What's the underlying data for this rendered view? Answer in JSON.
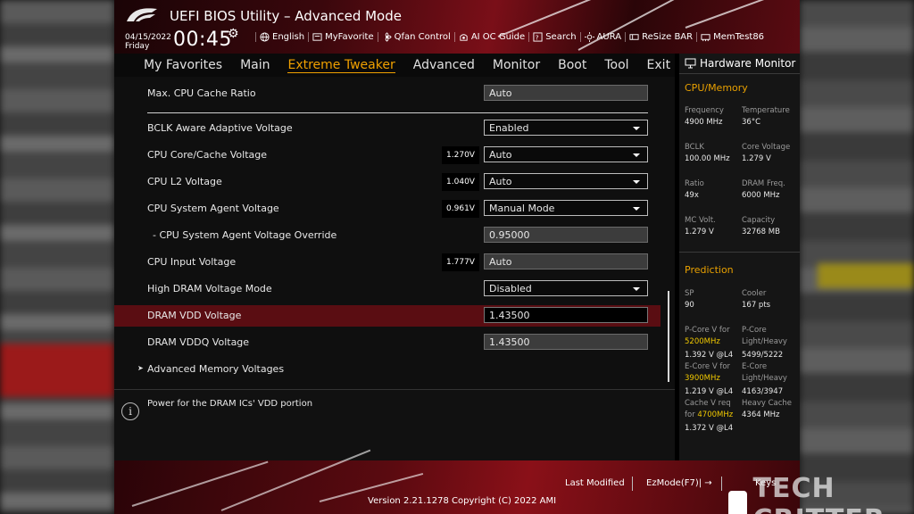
{
  "header": {
    "title": "UEFI BIOS Utility – Advanced Mode",
    "date": "04/15/2022",
    "day": "Friday",
    "time": "00:45",
    "tools": [
      {
        "icon": "globe-icon",
        "label": "English"
      },
      {
        "icon": "myfavorite-icon",
        "label": "MyFavorite"
      },
      {
        "icon": "fan-icon",
        "label": "Qfan Control"
      },
      {
        "icon": "ai-oc-icon",
        "label": "AI OC Guide"
      },
      {
        "icon": "search-icon",
        "label": "Search"
      },
      {
        "icon": "aura-icon",
        "label": "AURA"
      },
      {
        "icon": "resize-bar-icon",
        "label": "ReSize BAR"
      },
      {
        "icon": "memtest-icon",
        "label": "MemTest86"
      }
    ]
  },
  "nav": {
    "items": [
      "My Favorites",
      "Main",
      "Extreme Tweaker",
      "Advanced",
      "Monitor",
      "Boot",
      "Tool",
      "Exit"
    ],
    "active": "Extreme Tweaker"
  },
  "settings": {
    "max_cpu_cache_ratio": {
      "label": "Max. CPU Cache Ratio",
      "value": "Auto"
    },
    "bclk_aware": {
      "label": "BCLK Aware Adaptive Voltage",
      "value": "Enabled"
    },
    "cpu_core_cache": {
      "label": "CPU Core/Cache Voltage",
      "current": "1.270V",
      "value": "Auto"
    },
    "cpu_l2": {
      "label": "CPU L2 Voltage",
      "current": "1.040V",
      "value": "Auto"
    },
    "cpu_sa": {
      "label": "CPU System Agent Voltage",
      "current": "0.961V",
      "value": "Manual Mode"
    },
    "cpu_sa_override": {
      "label": "- CPU System Agent Voltage Override",
      "value": "0.95000"
    },
    "cpu_input": {
      "label": "CPU Input Voltage",
      "current": "1.777V",
      "value": "Auto"
    },
    "high_dram": {
      "label": "High DRAM Voltage Mode",
      "value": "Disabled"
    },
    "dram_vdd": {
      "label": "DRAM VDD Voltage",
      "value": "1.43500"
    },
    "dram_vddq": {
      "label": "DRAM VDDQ Voltage",
      "value": "1.43500"
    },
    "adv_mem": {
      "label": "Advanced Memory Voltages"
    }
  },
  "help": {
    "text": "Power for the DRAM ICs' VDD portion"
  },
  "hw_monitor": {
    "title": "Hardware Monitor",
    "cpu_memory_heading": "CPU/Memory",
    "frequency_label": "Frequency",
    "frequency": "4900 MHz",
    "temperature_label": "Temperature",
    "temperature": "36°C",
    "bclk_label": "BCLK",
    "bclk": "100.00 MHz",
    "core_voltage_label": "Core Voltage",
    "core_voltage": "1.279 V",
    "ratio_label": "Ratio",
    "ratio": "49x",
    "dram_freq_label": "DRAM Freq.",
    "dram_freq": "6000 MHz",
    "mc_volt_label": "MC Volt.",
    "mc_volt": "1.279 V",
    "capacity_label": "Capacity",
    "capacity": "32768 MB",
    "prediction_heading": "Prediction",
    "sp_label": "SP",
    "sp": "90",
    "cooler_label": "Cooler",
    "cooler": "167 pts",
    "pcore_v_for": "P-Core V for",
    "pcore_freq": "5200MHz",
    "pcore_v": "1.392 V @L4",
    "pcore_lh_label1": "P-Core",
    "pcore_lh_label2": "Light/Heavy",
    "pcore_lh": "5499/5222",
    "ecore_v_for": "E-Core V for",
    "ecore_freq": "3900MHz",
    "ecore_v": "1.219 V @L4",
    "ecore_lh_label1": "E-Core",
    "ecore_lh_label2": "Light/Heavy",
    "ecore_lh": "4163/3947",
    "cache_v_req": "Cache V req",
    "cache_for": "for",
    "cache_freq": "4700MHz",
    "cache_v": "1.372 V @L4",
    "heavy_cache_label": "Heavy Cache",
    "heavy_cache": "4364 MHz"
  },
  "footer": {
    "last_modified": "Last Modified",
    "ezmode": "EzMode(F7)|",
    "keys": "Keys",
    "version": "Version 2.21.1278 Copyright (C) 2022 AMI"
  },
  "watermark": "TECH CRITTER",
  "colors": {
    "accent": "#f0a000",
    "selected_row": "#5a0d12",
    "highlight_freq": "#f0c800"
  }
}
